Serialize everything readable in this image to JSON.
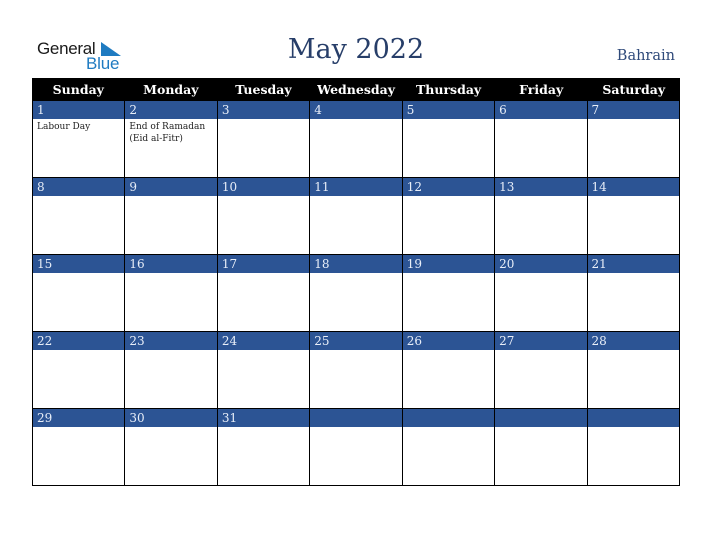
{
  "logo": {
    "word1": "General",
    "word2": "Blue",
    "accent_color": "#1f7bc1",
    "icon": "blue-triangle-icon"
  },
  "header": {
    "title": "May 2022",
    "country": "Bahrain"
  },
  "weekdays": [
    "Sunday",
    "Monday",
    "Tuesday",
    "Wednesday",
    "Thursday",
    "Friday",
    "Saturday"
  ],
  "colors": {
    "header_bg": "#000000",
    "day_bar": "#2c5494",
    "title": "#273e69"
  },
  "weeks": [
    [
      {
        "day": "1",
        "event": "Labour Day"
      },
      {
        "day": "2",
        "event": "End of Ramadan (Eid al-Fitr)"
      },
      {
        "day": "3",
        "event": ""
      },
      {
        "day": "4",
        "event": ""
      },
      {
        "day": "5",
        "event": ""
      },
      {
        "day": "6",
        "event": ""
      },
      {
        "day": "7",
        "event": ""
      }
    ],
    [
      {
        "day": "8",
        "event": ""
      },
      {
        "day": "9",
        "event": ""
      },
      {
        "day": "10",
        "event": ""
      },
      {
        "day": "11",
        "event": ""
      },
      {
        "day": "12",
        "event": ""
      },
      {
        "day": "13",
        "event": ""
      },
      {
        "day": "14",
        "event": ""
      }
    ],
    [
      {
        "day": "15",
        "event": ""
      },
      {
        "day": "16",
        "event": ""
      },
      {
        "day": "17",
        "event": ""
      },
      {
        "day": "18",
        "event": ""
      },
      {
        "day": "19",
        "event": ""
      },
      {
        "day": "20",
        "event": ""
      },
      {
        "day": "21",
        "event": ""
      }
    ],
    [
      {
        "day": "22",
        "event": ""
      },
      {
        "day": "23",
        "event": ""
      },
      {
        "day": "24",
        "event": ""
      },
      {
        "day": "25",
        "event": ""
      },
      {
        "day": "26",
        "event": ""
      },
      {
        "day": "27",
        "event": ""
      },
      {
        "day": "28",
        "event": ""
      }
    ],
    [
      {
        "day": "29",
        "event": ""
      },
      {
        "day": "30",
        "event": ""
      },
      {
        "day": "31",
        "event": ""
      },
      {
        "day": "",
        "event": ""
      },
      {
        "day": "",
        "event": ""
      },
      {
        "day": "",
        "event": ""
      },
      {
        "day": "",
        "event": ""
      }
    ]
  ]
}
